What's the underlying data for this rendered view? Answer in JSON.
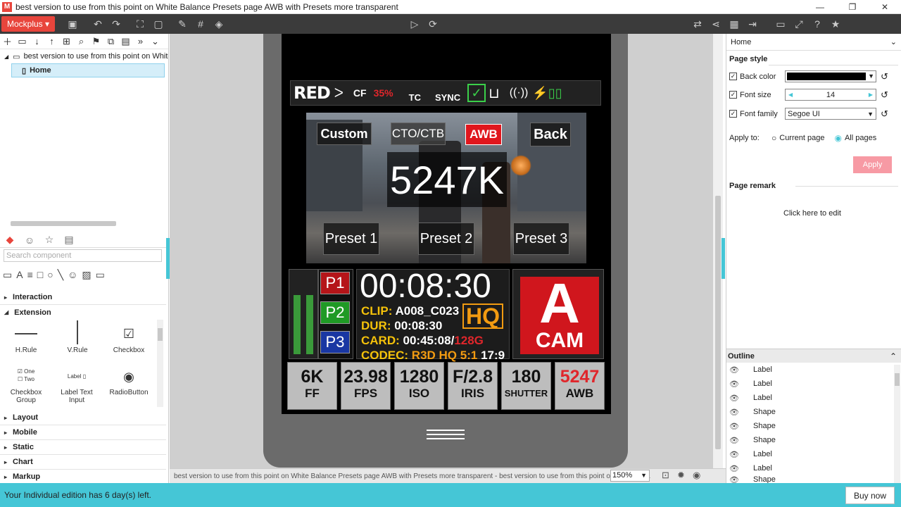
{
  "window": {
    "title": "best version to use from this point on White Balance Presets page AWB with Presets more transparent",
    "logo": "M"
  },
  "toolbar": {
    "brand": "Mockplus"
  },
  "tree": {
    "project": "best version to use from this point on White B",
    "page": "Home"
  },
  "components": {
    "search_placeholder": "Search component",
    "sections": [
      "Interaction",
      "Extension",
      "Layout",
      "Mobile",
      "Static",
      "Chart",
      "Markup"
    ],
    "items": [
      {
        "label": "H.Rule"
      },
      {
        "label": "V.Rule"
      },
      {
        "label": "Checkbox"
      },
      {
        "label": "Checkbox Group"
      },
      {
        "label": "Label Text Input"
      },
      {
        "label": "RadioButton"
      }
    ],
    "checkbox_group_options": [
      "One",
      "Two"
    ],
    "label_preview": "Label"
  },
  "device": {
    "topbar": {
      "brand": "RED",
      "cf_label": "CF",
      "cf_value": "35%",
      "tc": "TC",
      "sync": "SYNC"
    },
    "wb_buttons": {
      "custom": "Custom",
      "cto": "CTO/CTB",
      "awb": "AWB",
      "back": "Back"
    },
    "kelvin": "5247K",
    "presets": [
      "Preset 1",
      "Preset 2",
      "Preset 3"
    ],
    "pbuttons": [
      "P1",
      "P2",
      "P3"
    ],
    "meter_levels": [
      0.72,
      0.72
    ],
    "timecode": "00:08:30",
    "clip_label": "CLIP:",
    "clip_value": "A008_C023",
    "dur_label": "DUR:",
    "dur_value": "00:08:30",
    "card_label": "CARD:",
    "card_value": "00:45:08/",
    "card_size": "128G",
    "codec_label": "CODEC:",
    "codec_value": "R3D HQ 5:1",
    "codec_ratio": "17:9",
    "hq": "HQ",
    "cam_letter": "A",
    "cam_label": "CAM",
    "stats": [
      {
        "value": "6K",
        "label": "FF"
      },
      {
        "value": "23.98",
        "label": "FPS"
      },
      {
        "value": "1280",
        "label": "ISO"
      },
      {
        "value": "F/2.8",
        "label": "IRIS"
      },
      {
        "value": "180",
        "label": "SHUTTER"
      },
      {
        "value": "5247",
        "label": "AWB"
      }
    ]
  },
  "right_panel": {
    "page_name": "Home",
    "page_style": "Page style",
    "back_color_label": "Back color",
    "back_color_value": "#000000",
    "font_size_label": "Font size",
    "font_size_value": "14",
    "font_family_label": "Font family",
    "font_family_value": "Segoe UI",
    "apply_to_label": "Apply to:",
    "apply_current": "Current page",
    "apply_all": "All pages",
    "apply_button": "Apply",
    "remark_title": "Page remark",
    "remark_placeholder": "Click here to edit",
    "outline_title": "Outline",
    "outline_items": [
      "Label",
      "Label",
      "Label",
      "Shape",
      "Shape",
      "Shape",
      "Label",
      "Label",
      "Shape"
    ]
  },
  "statusbar": {
    "text": "best version to use from this point on White Balance Presets page AWB with Presets more transparent - best version to use from this point on White Bala",
    "zoom": "150%"
  },
  "banner": {
    "text": "Your Individual edition has 6 day(s) left.",
    "buy": "Buy now"
  }
}
